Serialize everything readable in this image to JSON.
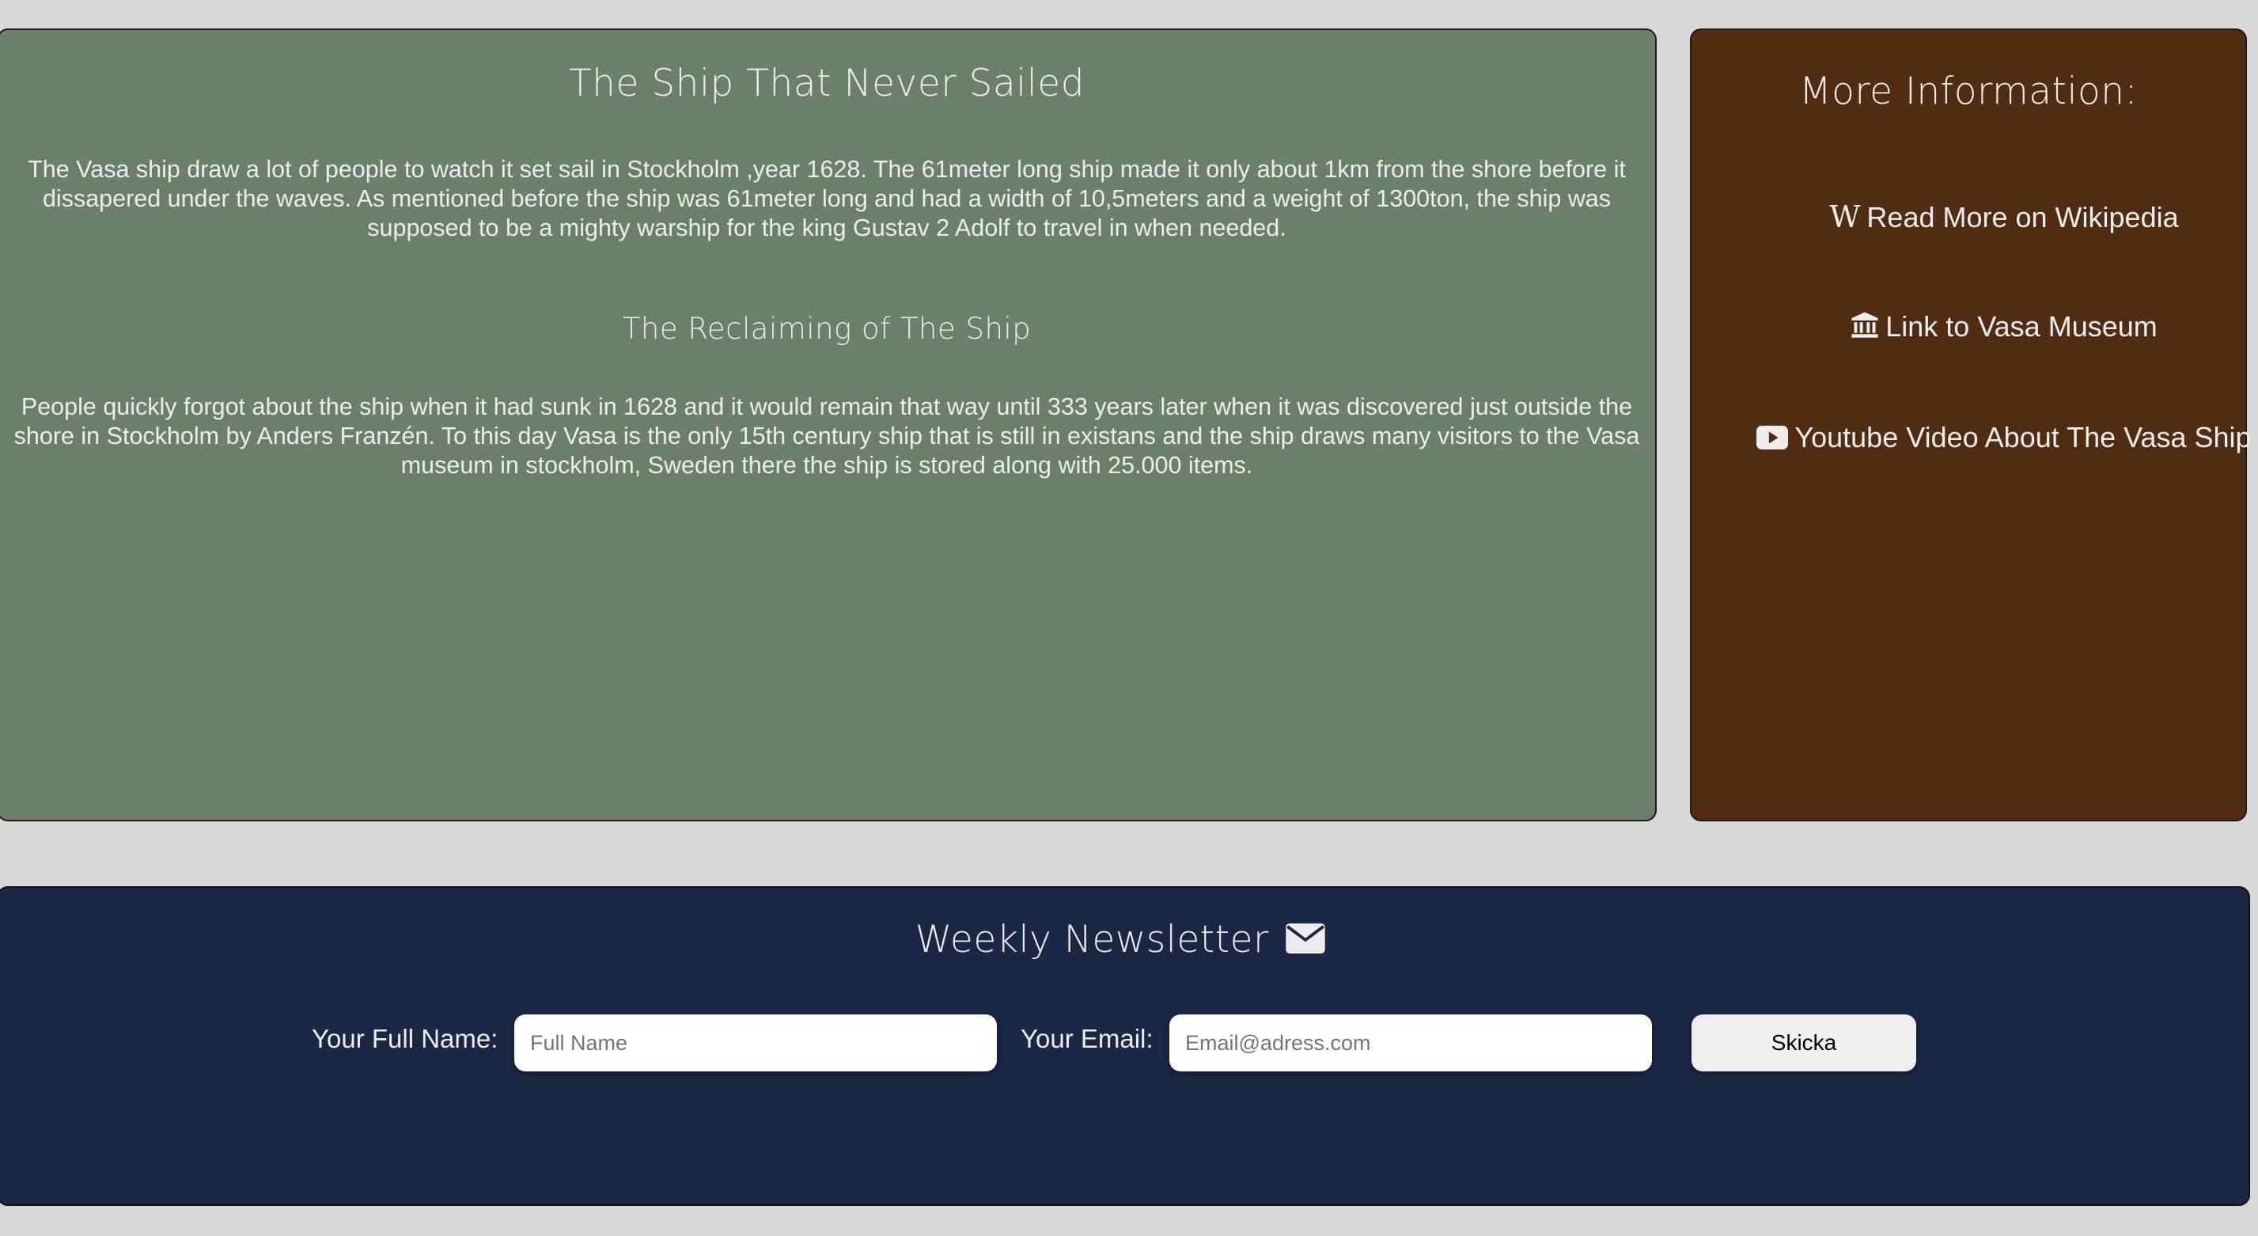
{
  "article": {
    "title": "The Ship That Never Sailed",
    "intro": "The Vasa ship draw a lot of people to watch it set sail in Stockholm ,year 1628. The 61meter long ship made it only about 1km from the shore before it dissapered under the waves. As mentioned before the ship was 61meter long and had a width of 10,5meters and a weight of 1300ton, the ship was supposed to be a mighty warship for the king Gustav 2 Adolf to travel in when needed.",
    "subtitle": "The Reclaiming of The Ship",
    "body": "People quickly forgot about the ship when it had sunk in 1628 and it would remain that way until 333 years later when it was discovered just outside the shore in Stockholm by Anders Franzén. To this day Vasa is the only 15th century ship that is still in existans and the ship draws many visitors to the Vasa museum in stockholm, Sweden there the ship is stored along with 25.000 items."
  },
  "sidebar": {
    "title": "More Information:",
    "links": [
      {
        "label": "Read More on Wikipedia",
        "icon": "wikipedia-icon"
      },
      {
        "label": "Link to Vasa Museum",
        "icon": "museum-icon"
      },
      {
        "label": "Youtube Video About The Vasa Ship",
        "icon": "youtube-icon"
      }
    ]
  },
  "newsletter": {
    "title": "Weekly Newsletter",
    "icon": "envelope-icon",
    "name_label": "Your Full Name:",
    "name_placeholder": "Full Name",
    "name_value": "",
    "email_label": "Your Email:",
    "email_placeholder": "Email@adress.com",
    "email_value": "",
    "submit_label": "Skicka"
  },
  "colors": {
    "background": "#d8d8d8",
    "article_panel": "#6b7f6b",
    "sidebar_panel": "#4f2c12",
    "newsletter_panel": "#1b2744",
    "text": "#ededed"
  }
}
